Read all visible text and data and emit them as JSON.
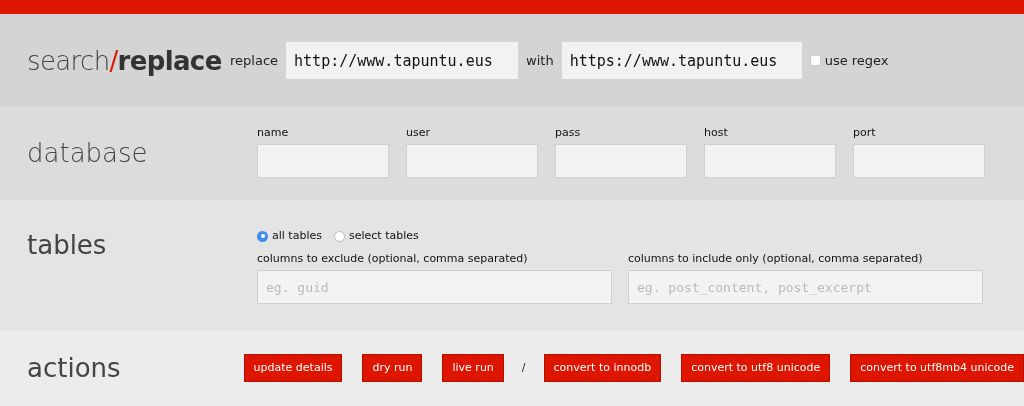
{
  "title": [
    {
      "text": "search",
      "kind": "light"
    },
    {
      "text": "/",
      "kind": "slash"
    },
    {
      "text": "replace",
      "kind": "bold"
    }
  ],
  "replace": {
    "label": "replace",
    "value": "http://www.tapuntu.eus",
    "with_label": "with",
    "with_value": "https://www.tapuntu.eus",
    "regex_label": "use regex",
    "regex_checked": false
  },
  "database": {
    "heading": "database",
    "fields": [
      {
        "label": "name"
      },
      {
        "label": "user"
      },
      {
        "label": "pass"
      },
      {
        "label": "host"
      },
      {
        "label": "port"
      }
    ]
  },
  "tables": {
    "heading": "tables",
    "options": [
      {
        "label": "all tables",
        "selected": true
      },
      {
        "label": "select tables",
        "selected": false
      }
    ],
    "columns": [
      {
        "label": "columns to exclude (optional, comma separated)",
        "placeholder": "eg. guid"
      },
      {
        "label": "columns to include only (optional, comma separated)",
        "placeholder": "eg. post_content, post_excerpt"
      }
    ]
  },
  "actions": {
    "heading": "actions",
    "items": [
      {
        "kind": "button",
        "label": "update details"
      },
      {
        "kind": "button",
        "label": "dry run"
      },
      {
        "kind": "button",
        "label": "live run"
      },
      {
        "kind": "separator",
        "label": "/"
      },
      {
        "kind": "button",
        "label": "convert to innodb"
      },
      {
        "kind": "button",
        "label": "convert to utf8 unicode"
      },
      {
        "kind": "button",
        "label": "convert to utf8mb4 unicode"
      }
    ]
  }
}
